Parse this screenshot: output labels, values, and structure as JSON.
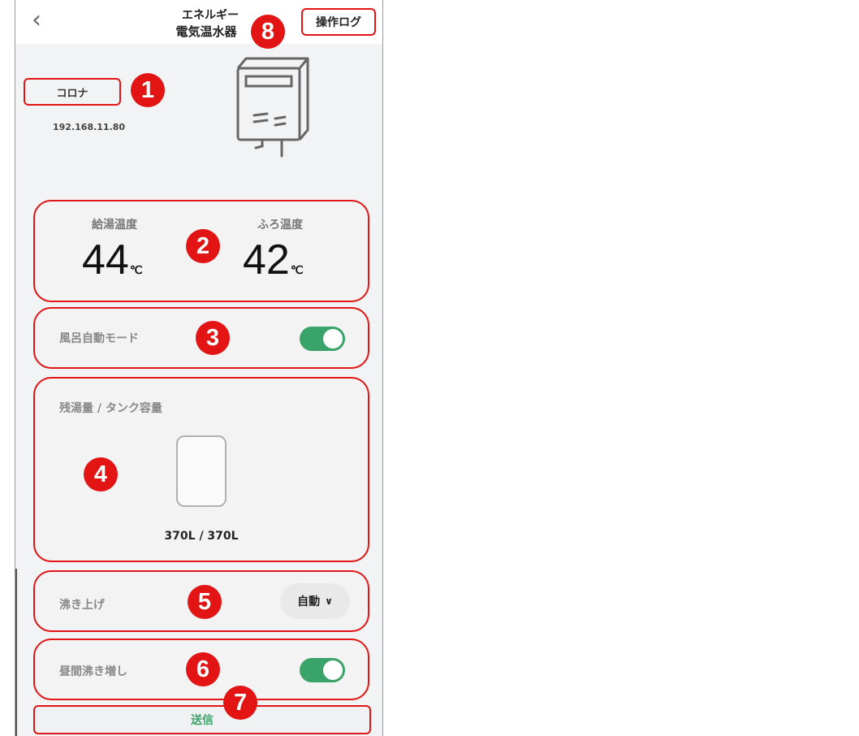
{
  "header": {
    "back_icon": "chevron-left-icon",
    "category": "エネルギー",
    "device_type": "電気温水器",
    "log_button": "操作ログ"
  },
  "device": {
    "name": "コロナ",
    "ip": "192.168.11.80",
    "image_icon": "water-heater-icon"
  },
  "temperatures": {
    "supply_label": "給湯温度",
    "supply_value": "44",
    "bath_label": "ふろ温度",
    "bath_value": "42",
    "unit": "℃"
  },
  "bath_auto": {
    "label": "風呂自動モード",
    "on": true
  },
  "tank": {
    "label": "残湯量 / タンク容量",
    "volume": "370L / 370L"
  },
  "boil": {
    "label": "沸き上げ",
    "value": "自動",
    "chevron_icon": "chevron-down-icon"
  },
  "day_boost": {
    "label": "昼間沸き増し",
    "on": true
  },
  "send_button": "送信",
  "markers": [
    "1",
    "2",
    "3",
    "4",
    "5",
    "6",
    "7",
    "8"
  ],
  "colors": {
    "accent_red": "#e31414",
    "toggle_green": "#3aa36a"
  }
}
